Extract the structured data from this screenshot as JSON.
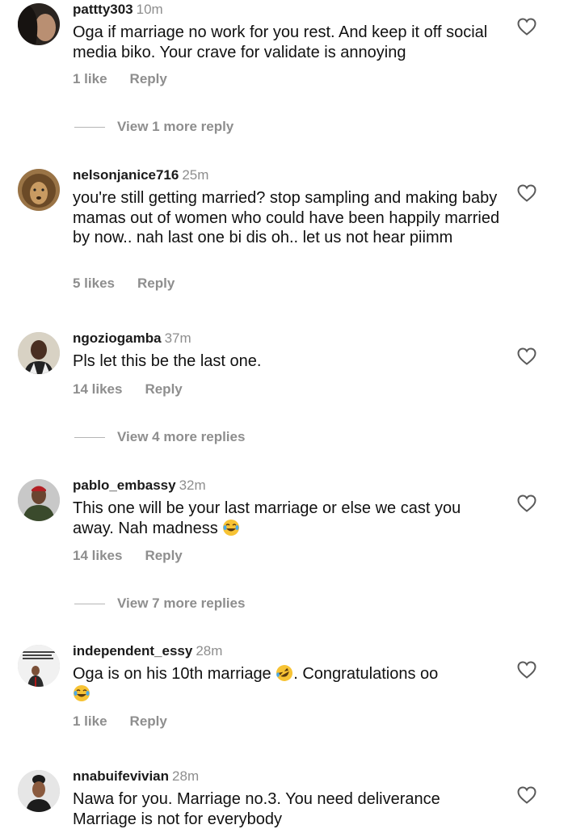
{
  "comments": [
    {
      "username": "pattty303",
      "time": "10m",
      "text": "Oga if marriage no work for you rest. And keep it off social media biko. Your crave for validate is annoying",
      "likes": "1 like",
      "reply_label": "Reply",
      "view_more": "View 1 more reply"
    },
    {
      "username": "nelsonjanice716",
      "time": "25m",
      "text": "you're still getting married? stop sampling and making baby mamas out of women who could have been happily married by now.. nah last one bi dis oh.. let us not hear piimm",
      "likes": "5 likes",
      "reply_label": "Reply"
    },
    {
      "username": "ngoziogamba",
      "time": "37m",
      "text": "Pls let this be the last one.",
      "likes": "14 likes",
      "reply_label": "Reply",
      "view_more": "View 4 more replies"
    },
    {
      "username": "pablo_embassy",
      "time": "32m",
      "text": "This one will be your last marriage or else we cast you away. Nah madness",
      "likes": "14 likes",
      "reply_label": "Reply",
      "view_more": "View 7 more replies"
    },
    {
      "username": "independent_essy",
      "time": "28m",
      "text_part1": "Oga is on his 10th marriage",
      "text_part2": ". Congratulations oo",
      "likes": "1 like",
      "reply_label": "Reply"
    },
    {
      "username": "nnabuifevivian",
      "time": "28m",
      "text": "Nawa for you. Marriage no.3. You need deliverance Marriage is not for everybody"
    }
  ],
  "icons": {
    "like": "heart-outline-icon",
    "laugh": "tears-of-joy-emoji",
    "rofl": "rolling-laughing-emoji"
  },
  "colors": {
    "muted": "#8e8e8e",
    "text": "#111111",
    "emoji": "#f7c334"
  }
}
